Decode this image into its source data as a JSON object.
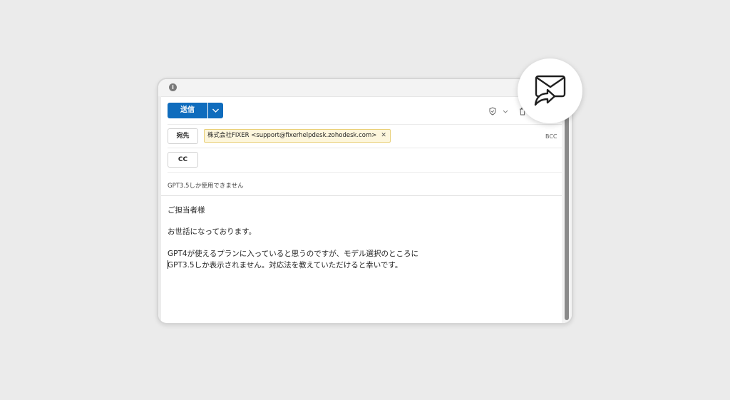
{
  "toolbar": {
    "send_label": "送信"
  },
  "recipients": {
    "to_label": "宛先",
    "to_chip": "株式会社FIXER <support@fixerhelpdesk.zohodesk.com>",
    "chip_close": "✕",
    "cc_label": "CC",
    "bcc_label": "BCC"
  },
  "subject": "GPT3.5しか使用できません",
  "body": {
    "line1": "ご担当者様",
    "line2": "お世話になっております。",
    "line3": "GPT4が使えるプランに入っていると思うのですが、モデル選択のところに",
    "line4": "GPT3.5しか表示されません。対応法を教えていただけると幸いです。"
  },
  "colors": {
    "accent": "#0f6cbd",
    "chip_bg": "#fdf6dc",
    "chip_border": "#e9cf76",
    "background": "#ebebeb"
  },
  "icons": {
    "info": "info-icon",
    "dropdown": "chevron-down-icon",
    "sensitivity": "shield-icon",
    "discard": "trash-icon",
    "forward_mail": "mail-forward-icon"
  }
}
